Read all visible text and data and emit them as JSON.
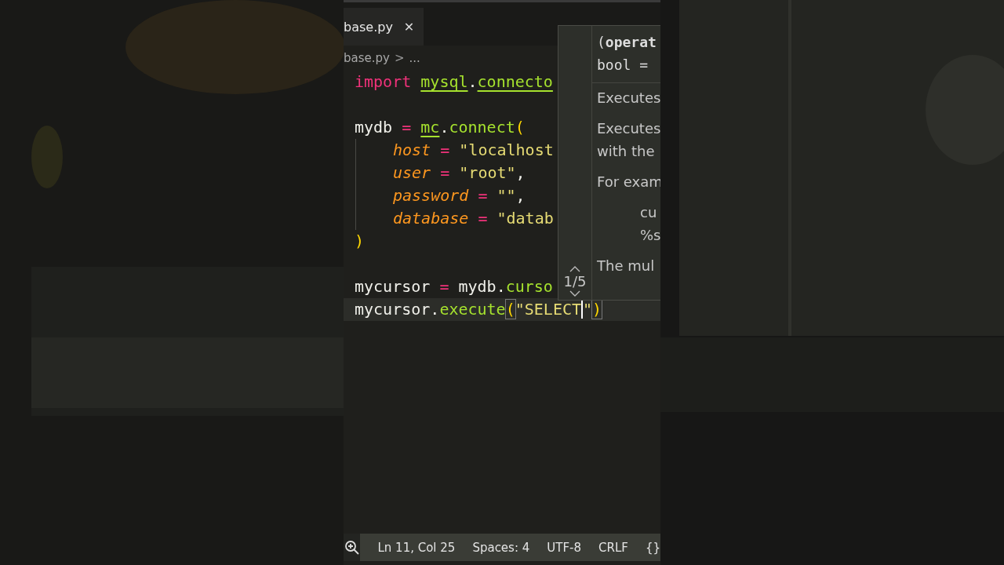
{
  "tab": {
    "label": "base.py",
    "close": "✕",
    "selected": true
  },
  "breadcrumb": {
    "file": "base.py",
    "separator": ">",
    "rest": "..."
  },
  "code": [
    {
      "kind": "normal",
      "tokens": [
        {
          "t": "import ",
          "kind": "keyword"
        },
        {
          "t": "mysql",
          "kind": "module"
        },
        {
          "t": ".",
          "kind": "plain"
        },
        {
          "t": "connecto",
          "kind": "module"
        }
      ]
    },
    {
      "kind": "blank"
    },
    {
      "kind": "normal",
      "tokens": [
        {
          "t": "mydb ",
          "kind": "plain"
        },
        {
          "t": "= ",
          "kind": "op"
        },
        {
          "t": "mc",
          "kind": "module"
        },
        {
          "t": ".",
          "kind": "plain"
        },
        {
          "t": "connect",
          "kind": "func"
        },
        {
          "t": "(",
          "kind": "paren"
        }
      ]
    },
    {
      "kind": "indented",
      "tokens": [
        {
          "t": "host ",
          "kind": "param"
        },
        {
          "t": "= ",
          "kind": "op"
        },
        {
          "t": "\"localhost",
          "kind": "string"
        }
      ]
    },
    {
      "kind": "indented",
      "tokens": [
        {
          "t": "user ",
          "kind": "param"
        },
        {
          "t": "= ",
          "kind": "op"
        },
        {
          "t": "\"root\"",
          "kind": "string"
        },
        {
          "t": ",",
          "kind": "plain"
        }
      ]
    },
    {
      "kind": "indented",
      "tokens": [
        {
          "t": "password ",
          "kind": "param"
        },
        {
          "t": "= ",
          "kind": "op"
        },
        {
          "t": "\"\"",
          "kind": "string"
        },
        {
          "t": ",",
          "kind": "plain"
        }
      ]
    },
    {
      "kind": "indented",
      "tokens": [
        {
          "t": "database ",
          "kind": "param"
        },
        {
          "t": "= ",
          "kind": "op"
        },
        {
          "t": "\"datab",
          "kind": "string"
        }
      ]
    },
    {
      "kind": "normal",
      "tokens": [
        {
          "t": ")",
          "kind": "paren"
        }
      ]
    },
    {
      "kind": "blank"
    },
    {
      "kind": "normal",
      "tokens": [
        {
          "t": "mycursor ",
          "kind": "plain"
        },
        {
          "t": "= ",
          "kind": "op"
        },
        {
          "t": "mydb.",
          "kind": "plain"
        },
        {
          "t": "curso",
          "kind": "func"
        }
      ]
    },
    {
      "kind": "current",
      "tokens": [
        {
          "t": "mycursor.",
          "kind": "plain"
        },
        {
          "t": "execute",
          "kind": "func"
        },
        {
          "t": "(",
          "kind": "match"
        },
        {
          "t": "\"SELECT",
          "kind": "string"
        },
        {
          "t": "\"",
          "kind": "string-caret"
        },
        {
          "t": ")",
          "kind": "match"
        }
      ]
    }
  ],
  "hover": {
    "signature": [
      "(**operat**",
      "bool = "
    ],
    "pager": {
      "count": "1/5"
    },
    "doc": [
      {
        "kind": "text",
        "t": "Executes"
      },
      {
        "kind": "text",
        "t": "Executes\nwith the"
      },
      {
        "kind": "text",
        "t": "For exam"
      },
      {
        "kind": "code",
        "t": "cu\n%s"
      },
      {
        "kind": "text",
        "t": "The mul"
      }
    ]
  },
  "status_bar": {
    "items": [
      "Ln 11, Col 25",
      "Spaces: 4",
      "UTF-8",
      "CRLF",
      "{}"
    ]
  }
}
